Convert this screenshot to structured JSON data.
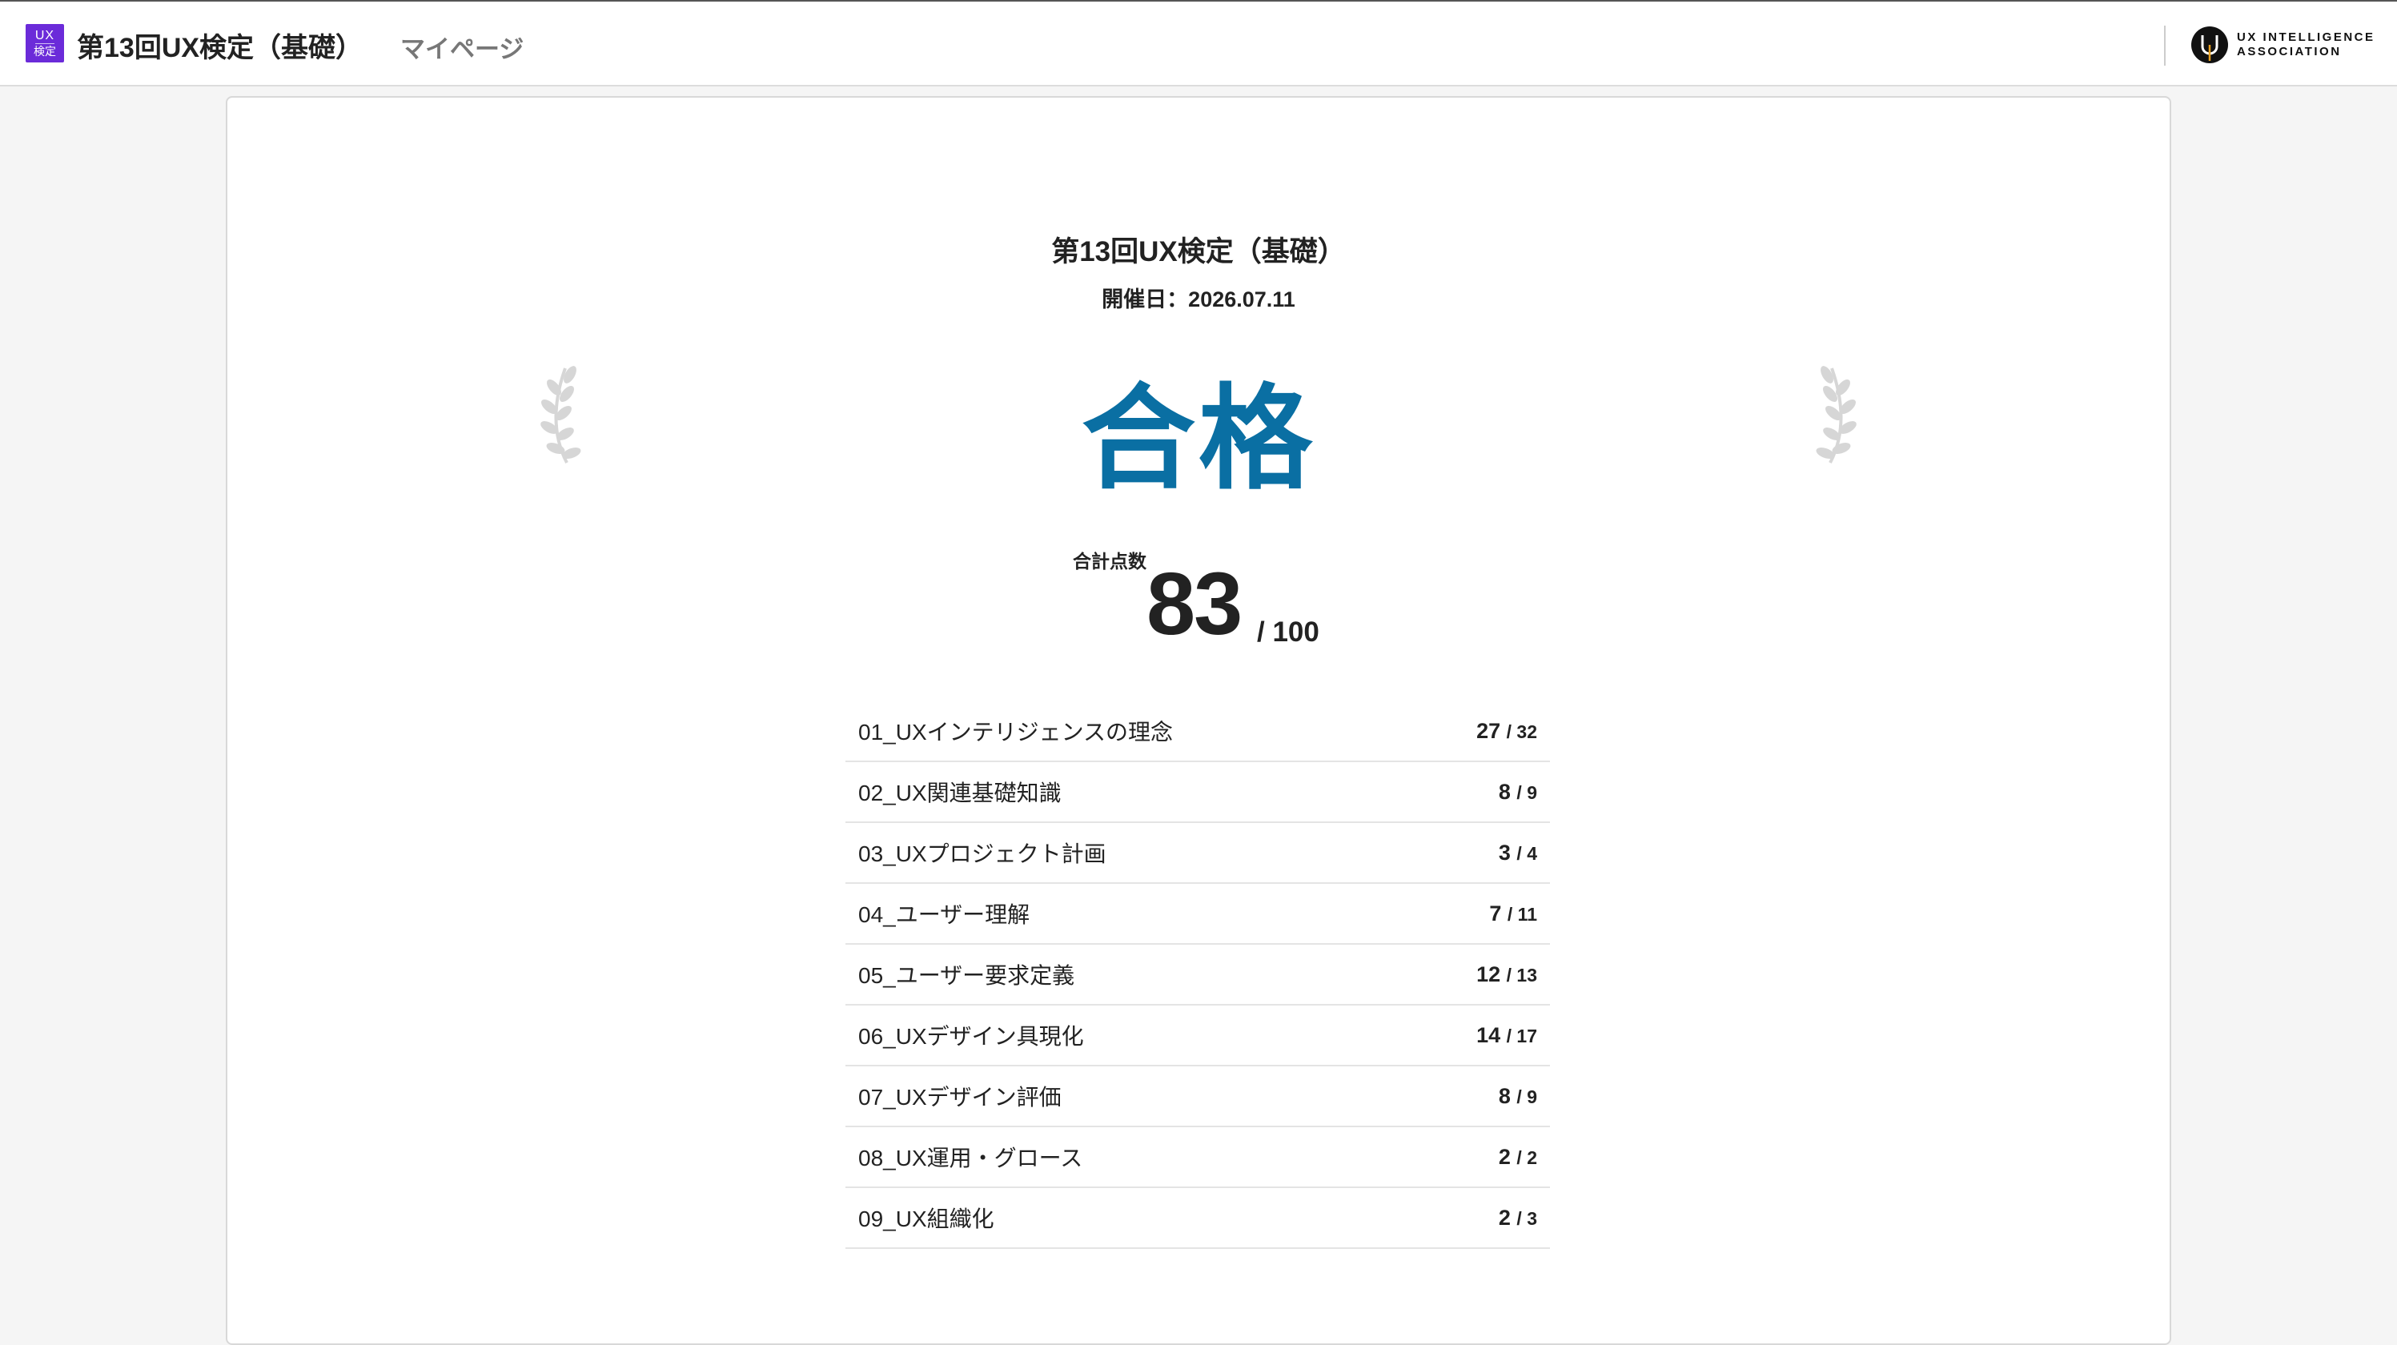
{
  "header": {
    "logo_line1": "UX",
    "logo_line2": "検定",
    "app_title": "第13回UX検定（基礎）",
    "mypage_link": "マイページ",
    "org_logo_line1": "UX INTELLIGENCE",
    "org_logo_line2": "ASSOCIATION"
  },
  "result_card": {
    "exam_title": "第13回UX検定（基礎）",
    "exam_date": "開催日：2026.07.11",
    "result": "合格",
    "total_label": "合計点数",
    "total_score": "83",
    "total_max": "/ 100"
  },
  "scores": [
    {
      "label": "01_UXインテリジェンスの理念",
      "score": "27",
      "max": "/ 32"
    },
    {
      "label": "02_UX関連基礎知識",
      "score": "8",
      "max": "/ 9"
    },
    {
      "label": "03_UXプロジェクト計画",
      "score": "3",
      "max": "/ 4"
    },
    {
      "label": "04_ユーザー理解",
      "score": "7",
      "max": "/ 11"
    },
    {
      "label": "05_ユーザー要求定義",
      "score": "12",
      "max": "/ 13"
    },
    {
      "label": "06_UXデザイン具現化",
      "score": "14",
      "max": "/ 17"
    },
    {
      "label": "07_UXデザイン評価",
      "score": "8",
      "max": "/ 9"
    },
    {
      "label": "08_UX運用・グロース",
      "score": "2",
      "max": "/ 2"
    },
    {
      "label": "09_UX組織化",
      "score": "2",
      "max": "/ 3"
    }
  ],
  "colors": {
    "brand_purple": "#6b2bd9",
    "pass_blue": "#0a6fa3"
  },
  "icons": {
    "laurel_left": "laurel-left-icon",
    "laurel_right": "laurel-right-icon",
    "org_logo": "uxia-logo-icon"
  }
}
